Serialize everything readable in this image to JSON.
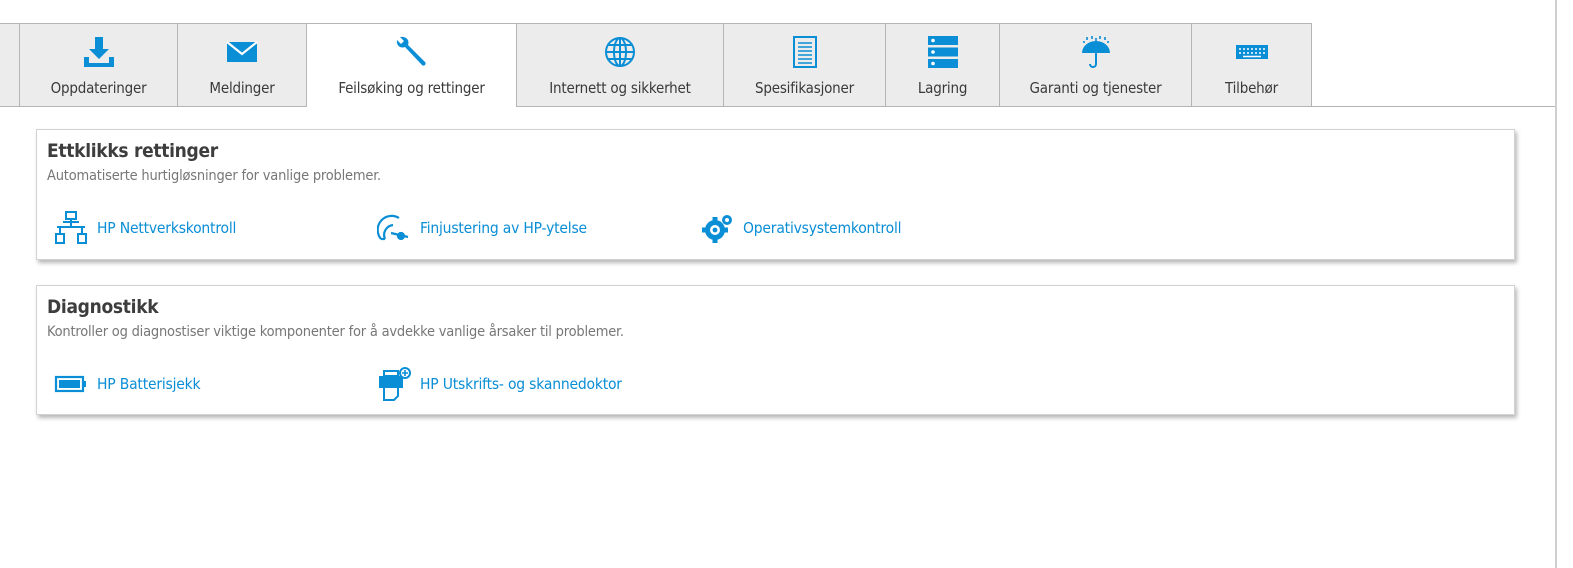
{
  "tabs": [
    {
      "label": "",
      "icon": "partial-tab-edge"
    },
    {
      "label": "Oppdateringer",
      "icon": "download-icon"
    },
    {
      "label": "Meldinger",
      "icon": "envelope-icon"
    },
    {
      "label": "Feilsøking og rettinger",
      "icon": "wrench-icon",
      "active": true
    },
    {
      "label": "Internett og sikkerhet",
      "icon": "globe-icon"
    },
    {
      "label": "Spesifikasjoner",
      "icon": "document-icon"
    },
    {
      "label": "Lagring",
      "icon": "storage-icon"
    },
    {
      "label": "Garanti og tjenester",
      "icon": "umbrella-icon"
    },
    {
      "label": "Tilbehør",
      "icon": "keyboard-icon"
    }
  ],
  "sections": {
    "quickfix": {
      "title": "Ettklikks rettinger",
      "description": "Automatiserte hurtigløsninger for vanlige problemer.",
      "items": [
        {
          "label": "HP Nettverkskontroll",
          "icon": "network-icon"
        },
        {
          "label": "Finjustering av HP-ytelse",
          "icon": "performance-gauge-icon"
        },
        {
          "label": "Operativsystemkontroll",
          "icon": "gears-icon"
        }
      ]
    },
    "diagnostics": {
      "title": "Diagnostikk",
      "description": "Kontroller og diagnostiser viktige komponenter for å avdekke vanlige årsaker til problemer.",
      "items": [
        {
          "label": "HP Batterisjekk",
          "icon": "battery-icon"
        },
        {
          "label": "HP Utskrifts- og skannedoktor",
          "icon": "printer-doctor-icon"
        }
      ]
    }
  },
  "colors": {
    "accent": "#0a8ed6",
    "tab_bg": "#ececec",
    "border": "#b5b5b5",
    "text": "#3a3a3a",
    "muted": "#777777"
  }
}
